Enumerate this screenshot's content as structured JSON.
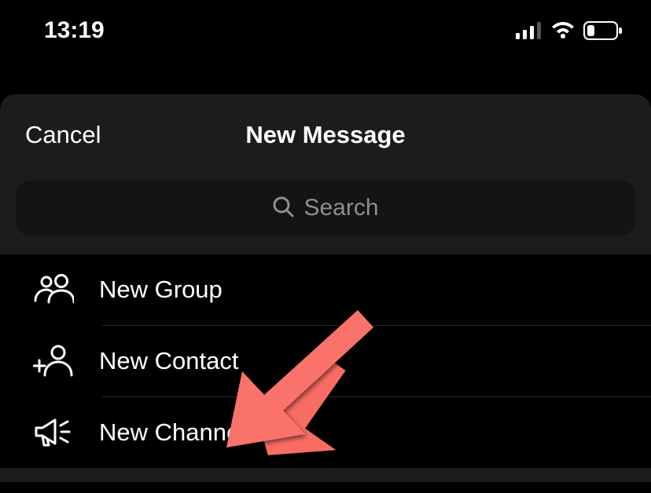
{
  "statusBar": {
    "time": "13:19"
  },
  "modal": {
    "cancel": "Cancel",
    "title": "New Message"
  },
  "search": {
    "placeholder": "Search"
  },
  "options": {
    "newGroup": "New Group",
    "newContact": "New Contact",
    "newChannel": "New Channel"
  }
}
